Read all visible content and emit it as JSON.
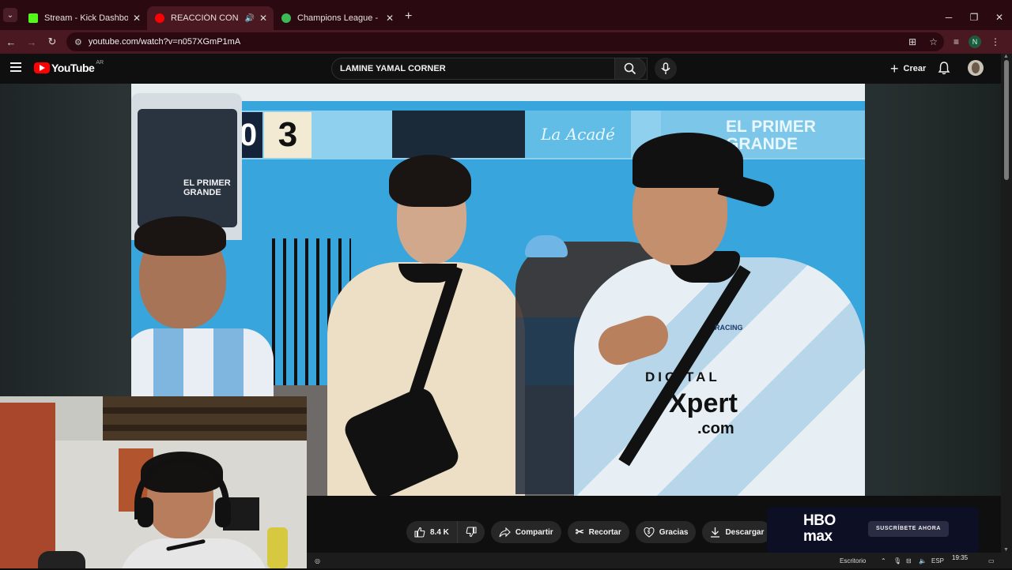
{
  "browser": {
    "tabs": [
      {
        "title": "Stream - Kick Dashboard",
        "active": false,
        "favicon_color": "#53fc18"
      },
      {
        "title": "REACCIÓN CON LOS HINCHAS",
        "active": true,
        "favicon_color": "#ff0000"
      },
      {
        "title": "Champions League - POSICIONES",
        "active": false,
        "favicon_color": "#3cba54"
      }
    ],
    "new_tab_icon": "plus-icon",
    "url": "youtube.com/watch?v=n057XGmP1mA",
    "profile_initial": "N"
  },
  "youtube": {
    "logo_text": "YouTube",
    "country_code": "AR",
    "search_value": "LAMINE YAMAL CORNER",
    "create_label": "Crear"
  },
  "video_scene": {
    "sign_number": "3",
    "sign_zero": "0",
    "sign_academia": "La Acadé",
    "sign_el_primer": "EL PRIMER",
    "sign_grande": "GRANDE",
    "bus_line1": "EL PRIMER",
    "bus_line2": "GRANDE",
    "jersey_brand": "RACING",
    "jersey_sponsor_1": "DIGITAL",
    "jersey_sponsor_2": "Xpert",
    "jersey_sponsor_3": ".com"
  },
  "actions": {
    "like_count": "8.4 K",
    "share": "Compartir",
    "clip": "Recortar",
    "thanks": "Gracias",
    "download": "Descargar"
  },
  "ad": {
    "brand_line1": "HBO",
    "brand_line2": "max",
    "cta": "SUSCRÍBETE AHORA"
  },
  "taskbar": {
    "desktop_label": "Escritorio",
    "language": "ESP",
    "time": "19:35"
  },
  "colors": {
    "youtube_red": "#ff0000",
    "tab_bar": "#2a0a10",
    "active_tab": "#4a1820"
  }
}
